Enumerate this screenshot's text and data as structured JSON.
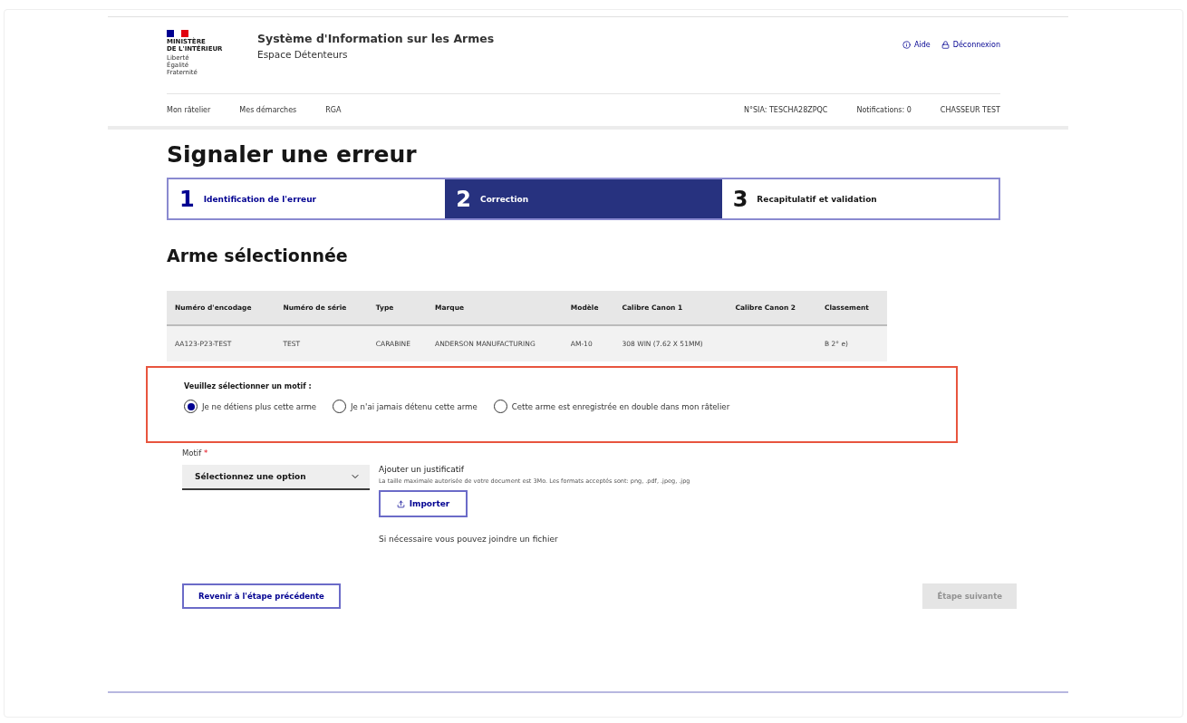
{
  "header": {
    "logo": {
      "ministry": "MINISTÈRE\nDE L'INTÉRIEUR",
      "motto": "Liberté\nÉgalité\nFraternité"
    },
    "title": "Système d'Information sur les Armes",
    "subtitle": "Espace Détenteurs",
    "links": [
      "Aide",
      "Déconnexion"
    ]
  },
  "nav": {
    "items": [
      "Mon râtelier",
      "Mes démarches",
      "RGA"
    ],
    "info": [
      "N°SIA: TESCHA28ZPQC",
      "Notifications: 0",
      "CHASSEUR TEST"
    ]
  },
  "page_title": "Signaler une erreur",
  "steps": [
    {
      "number": "1",
      "label": "Identification de l'erreur",
      "completed": true,
      "selected": false
    },
    {
      "number": "2",
      "label": "Correction",
      "completed": false,
      "selected": true
    },
    {
      "number": "3",
      "label": "Recapitulatif et validation",
      "completed": false,
      "selected": false
    }
  ],
  "section_title": "Arme sélectionnée",
  "table": {
    "columns": [
      "Numéro d'encodage",
      "Numéro de série",
      "Type",
      "Marque",
      "Modèle",
      "Calibre Canon 1",
      "Calibre Canon 2",
      "Classement"
    ],
    "rows": [
      [
        "AA123-P23-TEST",
        "TEST",
        "CARABINE",
        "ANDERSON MANUFACTURING",
        "AM-10",
        "308 WIN (7.62 X 51MM)",
        "",
        "B 2° e)"
      ]
    ]
  },
  "reason": {
    "label": "Veuillez sélectionner un motif :",
    "options": [
      {
        "label": "Je ne détiens plus cette arme",
        "selected": true
      },
      {
        "label": "Je n'ai jamais détenu cette arme",
        "selected": false
      },
      {
        "label": "Cette arme est enregistrée en double dans mon râtelier",
        "selected": false
      }
    ]
  },
  "motif": {
    "label": "Motif",
    "required": "*",
    "placeholder": "Sélectionnez une option"
  },
  "attachment": {
    "title": "Ajouter un justificatif",
    "hint": "La taille maximale autorisée de votre document est 3Mo. Les formats acceptés sont: png, .pdf, .jpeg, .jpg",
    "button": "Importer",
    "note": "Si nécessaire vous pouvez joindre un fichier"
  },
  "buttons": [
    {
      "label": "Revenir à l'étape précédente",
      "disabled": false
    },
    {
      "label": "Étape suivante",
      "disabled": true
    }
  ]
}
